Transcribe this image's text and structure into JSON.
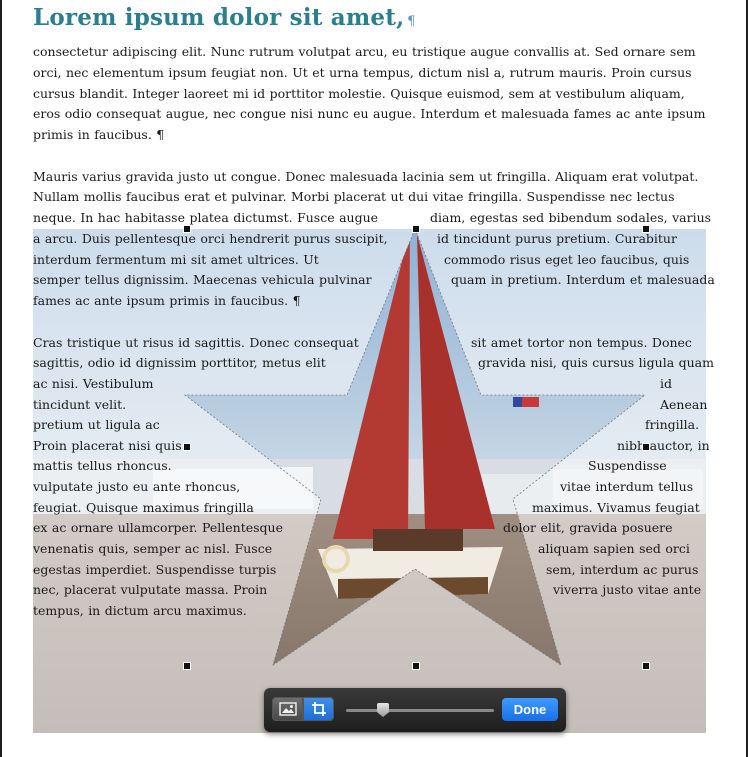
{
  "document": {
    "heading": "Lorem ipsum dolor sit amet,",
    "pilcrow": "¶",
    "lines": [
      "consectetur adipiscing elit. Nunc rutrum volutpat arcu, eu tristique augue convallis at. Sed ornare sem",
      "orci, nec elementum ipsum feugiat non. Ut et urna tempus, dictum nisl a, rutrum mauris. Proin cursus",
      "cursus blandit. Integer laoreet mi id porttitor molestie. Quisque euismod, sem at vestibulum aliquam,",
      "eros odio consequat augue, nec congue nisi nunc eu augue. Interdum et malesuada fames ac ante ipsum",
      "primis in faucibus. ¶",
      "Mauris varius gravida justo ut congue. Donec malesuada lacinia sem ut fringilla. Aliquam erat volutpat.",
      "Nullam mollis faucibus erat et pulvinar. Morbi placerat ut dui vitae fringilla. Suspendisse nec lectus",
      "neque. In hac habitasse platea dictumst. Fusce augue",
      "diam, egestas sed bibendum sodales, varius",
      "a arcu. Duis pellentesque orci hendrerit purus suscipit,",
      "id tincidunt purus pretium. Curabitur",
      "interdum fermentum mi sit amet ultrices. Ut",
      "commodo risus eget leo faucibus, quis",
      "semper tellus dignissim. Maecenas vehicula pulvinar",
      "quam in pretium. Interdum et malesuada",
      "fames ac ante ipsum primis in faucibus. ¶",
      "Cras tristique ut risus id sagittis. Donec consequat",
      "sit amet tortor non tempus. Donec",
      "sagittis, odio id dignissim porttitor, metus elit",
      "gravida nisi, quis cursus ligula quam",
      "ac nisi. Vestibulum",
      "id",
      "tincidunt velit.",
      "Aenean",
      "pretium ut ligula ac",
      "fringilla.",
      "Proin placerat nisi quis",
      "nibh auctor, in",
      "mattis tellus rhoncus.",
      "Suspendisse",
      "vulputate justo eu ante rhoncus,",
      "vitae interdum tellus",
      "feugiat. Quisque maximus fringilla",
      "maximus. Vivamus feugiat",
      "ex ac ornare ullamcorper. Pellentesque",
      "dolor elit, gravida posuere",
      "venenatis quis, semper ac nisl. Fusce",
      "aliquam sapien sed orci",
      "egestas imperdiet. Suspendisse turpis",
      "sem, interdum ac purus",
      "nec, placerat vulputate massa. Proin",
      "viverra justo vitae ante",
      "tempus, in dictum arcu maximus."
    ]
  },
  "image": {
    "subject": "sailboat-with-red-sails",
    "mask_shape": "star"
  },
  "toolbar": {
    "image_button_icon": "picture-icon",
    "crop_button_icon": "crop-icon",
    "slider_value": 0.25,
    "done_label": "Done"
  },
  "colors": {
    "heading": "#2a7f8a",
    "accent": "#1e6fd6",
    "sail": "#b23a33"
  }
}
